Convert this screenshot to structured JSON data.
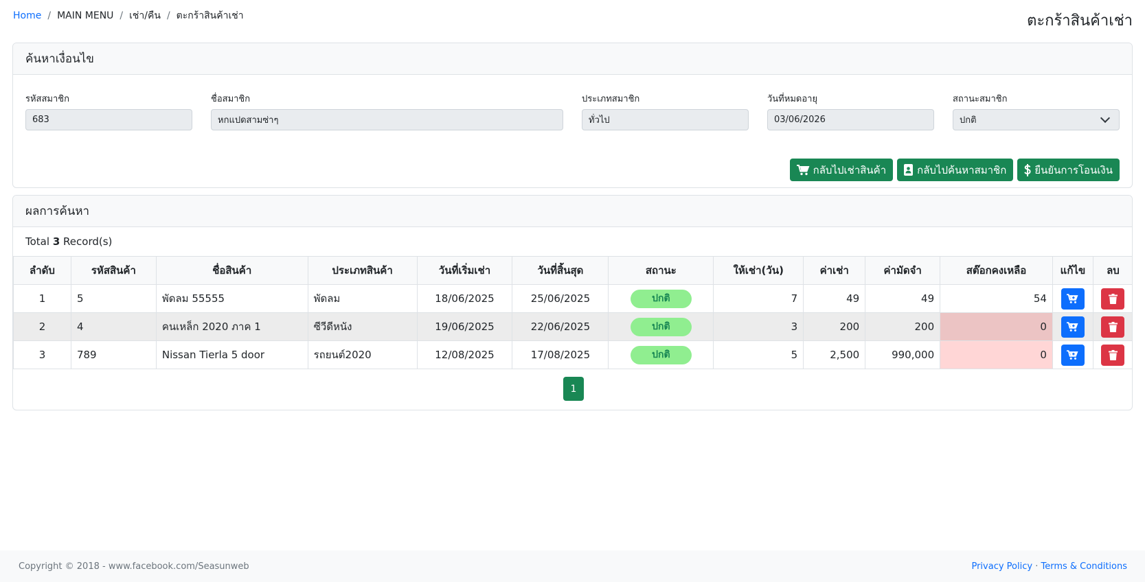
{
  "breadcrumb": {
    "home": "Home",
    "main_menu": "MAIN MENU",
    "rent_return": "เช่า/คืน",
    "current": "ตะกร้าสินค้าเช่า",
    "separator": "/"
  },
  "page_title": "ตะกร้าสินค้าเช่า",
  "search": {
    "header": "ค้นหาเงื่อนไข",
    "member_id_label": "รหัสสมาชิก",
    "member_id_value": "683",
    "member_name_label": "ชื่อสมาชิก",
    "member_name_value": "หกแปดสามซ่าๆ",
    "member_type_label": "ประเภทสมาชิก",
    "member_type_value": "ทั่วไป",
    "expiry_label": "วันที่หมดอายุ",
    "expiry_value": "03/06/2026",
    "status_label": "สถานะสมาชิก",
    "status_value": "ปกติ",
    "buttons": {
      "back_to_rent": "กลับไปเช่าสินค้า",
      "back_to_member_search": "กลับไปค้นหาสมาชิก",
      "confirm_transfer": "ยืนยันการโอนเงิน"
    }
  },
  "results": {
    "header": "ผลการค้นหา",
    "total_prefix": "Total",
    "total_count": "3",
    "total_suffix": "Record(s)",
    "columns": [
      "ลำดับ",
      "รหัสสินค้า",
      "ชื่อสินค้า",
      "ประเภทสินค้า",
      "วันที่เริ่มเช่า",
      "วันที่สิ้นสุด",
      "สถานะ",
      "ให้เช่า(วัน)",
      "ค่าเช่า",
      "ค่ามัดจำ",
      "สต๊อกคงเหลือ",
      "แก้ไข",
      "ลบ"
    ],
    "rows": [
      {
        "no": "1",
        "code": "5",
        "name": "พัดลม 55555",
        "type": "พัดลม",
        "start": "18/06/2025",
        "end": "25/06/2025",
        "status": "ปกติ",
        "days": "7",
        "rent": "49",
        "deposit": "49",
        "stock": "54"
      },
      {
        "no": "2",
        "code": "4",
        "name": "คนเหล็ก 2020 ภาค 1",
        "type": "ซีวีดีหนัง",
        "start": "19/06/2025",
        "end": "22/06/2025",
        "status": "ปกติ",
        "days": "3",
        "rent": "200",
        "deposit": "200",
        "stock": "0"
      },
      {
        "no": "3",
        "code": "789",
        "name": "Nissan Tierla 5 door",
        "type": "รถยนต์2020",
        "start": "12/08/2025",
        "end": "17/08/2025",
        "status": "ปกติ",
        "days": "5",
        "rent": "2,500",
        "deposit": "990,000",
        "stock": "0"
      }
    ],
    "current_page": "1"
  },
  "footer": {
    "copyright": "Copyright © 2018 - www.facebook.com/Seasunweb",
    "privacy": "Privacy Policy",
    "dot": "·",
    "terms": "Terms & Conditions"
  },
  "colors": {
    "success": "#198754",
    "primary": "#0d6efd",
    "danger": "#dc3545",
    "badge_bg": "#90ee90",
    "stock_warning": "#ffd6d6"
  },
  "icons": {
    "back_to_rent": "cart-icon",
    "back_to_member_search": "address-book-icon",
    "confirm_transfer": "dollar-icon",
    "edit": "cart-icon",
    "delete": "trash-icon"
  }
}
